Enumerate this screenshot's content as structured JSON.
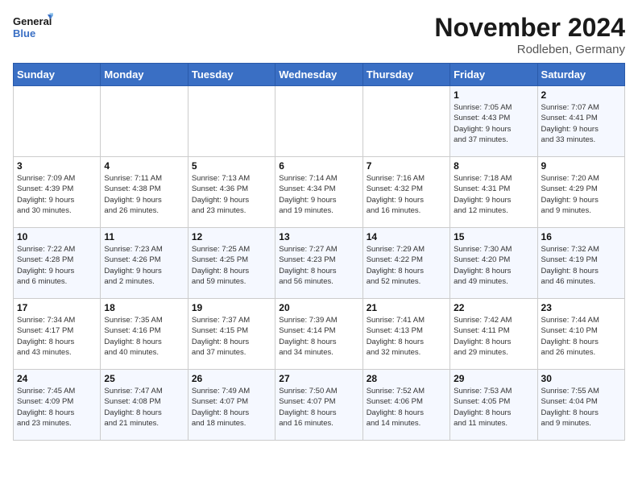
{
  "logo": {
    "line1": "General",
    "line2": "Blue"
  },
  "title": "November 2024",
  "location": "Rodleben, Germany",
  "days_of_week": [
    "Sunday",
    "Monday",
    "Tuesday",
    "Wednesday",
    "Thursday",
    "Friday",
    "Saturday"
  ],
  "weeks": [
    [
      {
        "day": "",
        "info": ""
      },
      {
        "day": "",
        "info": ""
      },
      {
        "day": "",
        "info": ""
      },
      {
        "day": "",
        "info": ""
      },
      {
        "day": "",
        "info": ""
      },
      {
        "day": "1",
        "info": "Sunrise: 7:05 AM\nSunset: 4:43 PM\nDaylight: 9 hours\nand 37 minutes."
      },
      {
        "day": "2",
        "info": "Sunrise: 7:07 AM\nSunset: 4:41 PM\nDaylight: 9 hours\nand 33 minutes."
      }
    ],
    [
      {
        "day": "3",
        "info": "Sunrise: 7:09 AM\nSunset: 4:39 PM\nDaylight: 9 hours\nand 30 minutes."
      },
      {
        "day": "4",
        "info": "Sunrise: 7:11 AM\nSunset: 4:38 PM\nDaylight: 9 hours\nand 26 minutes."
      },
      {
        "day": "5",
        "info": "Sunrise: 7:13 AM\nSunset: 4:36 PM\nDaylight: 9 hours\nand 23 minutes."
      },
      {
        "day": "6",
        "info": "Sunrise: 7:14 AM\nSunset: 4:34 PM\nDaylight: 9 hours\nand 19 minutes."
      },
      {
        "day": "7",
        "info": "Sunrise: 7:16 AM\nSunset: 4:32 PM\nDaylight: 9 hours\nand 16 minutes."
      },
      {
        "day": "8",
        "info": "Sunrise: 7:18 AM\nSunset: 4:31 PM\nDaylight: 9 hours\nand 12 minutes."
      },
      {
        "day": "9",
        "info": "Sunrise: 7:20 AM\nSunset: 4:29 PM\nDaylight: 9 hours\nand 9 minutes."
      }
    ],
    [
      {
        "day": "10",
        "info": "Sunrise: 7:22 AM\nSunset: 4:28 PM\nDaylight: 9 hours\nand 6 minutes."
      },
      {
        "day": "11",
        "info": "Sunrise: 7:23 AM\nSunset: 4:26 PM\nDaylight: 9 hours\nand 2 minutes."
      },
      {
        "day": "12",
        "info": "Sunrise: 7:25 AM\nSunset: 4:25 PM\nDaylight: 8 hours\nand 59 minutes."
      },
      {
        "day": "13",
        "info": "Sunrise: 7:27 AM\nSunset: 4:23 PM\nDaylight: 8 hours\nand 56 minutes."
      },
      {
        "day": "14",
        "info": "Sunrise: 7:29 AM\nSunset: 4:22 PM\nDaylight: 8 hours\nand 52 minutes."
      },
      {
        "day": "15",
        "info": "Sunrise: 7:30 AM\nSunset: 4:20 PM\nDaylight: 8 hours\nand 49 minutes."
      },
      {
        "day": "16",
        "info": "Sunrise: 7:32 AM\nSunset: 4:19 PM\nDaylight: 8 hours\nand 46 minutes."
      }
    ],
    [
      {
        "day": "17",
        "info": "Sunrise: 7:34 AM\nSunset: 4:17 PM\nDaylight: 8 hours\nand 43 minutes."
      },
      {
        "day": "18",
        "info": "Sunrise: 7:35 AM\nSunset: 4:16 PM\nDaylight: 8 hours\nand 40 minutes."
      },
      {
        "day": "19",
        "info": "Sunrise: 7:37 AM\nSunset: 4:15 PM\nDaylight: 8 hours\nand 37 minutes."
      },
      {
        "day": "20",
        "info": "Sunrise: 7:39 AM\nSunset: 4:14 PM\nDaylight: 8 hours\nand 34 minutes."
      },
      {
        "day": "21",
        "info": "Sunrise: 7:41 AM\nSunset: 4:13 PM\nDaylight: 8 hours\nand 32 minutes."
      },
      {
        "day": "22",
        "info": "Sunrise: 7:42 AM\nSunset: 4:11 PM\nDaylight: 8 hours\nand 29 minutes."
      },
      {
        "day": "23",
        "info": "Sunrise: 7:44 AM\nSunset: 4:10 PM\nDaylight: 8 hours\nand 26 minutes."
      }
    ],
    [
      {
        "day": "24",
        "info": "Sunrise: 7:45 AM\nSunset: 4:09 PM\nDaylight: 8 hours\nand 23 minutes."
      },
      {
        "day": "25",
        "info": "Sunrise: 7:47 AM\nSunset: 4:08 PM\nDaylight: 8 hours\nand 21 minutes."
      },
      {
        "day": "26",
        "info": "Sunrise: 7:49 AM\nSunset: 4:07 PM\nDaylight: 8 hours\nand 18 minutes."
      },
      {
        "day": "27",
        "info": "Sunrise: 7:50 AM\nSunset: 4:07 PM\nDaylight: 8 hours\nand 16 minutes."
      },
      {
        "day": "28",
        "info": "Sunrise: 7:52 AM\nSunset: 4:06 PM\nDaylight: 8 hours\nand 14 minutes."
      },
      {
        "day": "29",
        "info": "Sunrise: 7:53 AM\nSunset: 4:05 PM\nDaylight: 8 hours\nand 11 minutes."
      },
      {
        "day": "30",
        "info": "Sunrise: 7:55 AM\nSunset: 4:04 PM\nDaylight: 8 hours\nand 9 minutes."
      }
    ]
  ]
}
